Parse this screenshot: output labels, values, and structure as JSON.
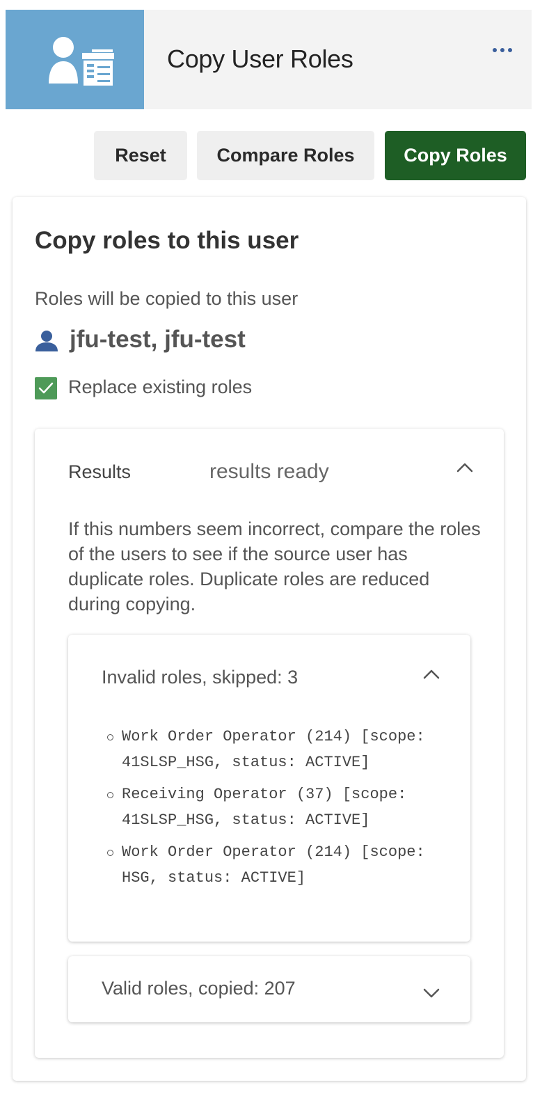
{
  "header": {
    "title": "Copy User Roles",
    "icon": "user-copier-icon",
    "more_icon": "more-horizontal-icon",
    "icon_bg_color": "#6aa6d0"
  },
  "toolbar": {
    "reset_label": "Reset",
    "compare_label": "Compare Roles",
    "copy_label": "Copy Roles",
    "copy_color": "#1e5e25"
  },
  "target": {
    "title": "Copy roles to this user",
    "subtitle": "Roles will be copied to this user",
    "user_icon": "user-icon",
    "user_name": "jfu-test, jfu-test",
    "replace_checked": true,
    "replace_label": "Replace existing roles"
  },
  "results": {
    "label": "Results",
    "status": "results ready",
    "expanded": true,
    "description": "If this numbers seem incorrect, compare the roles of the users to see if the source user has duplicate roles. Duplicate roles are reduced during copying.",
    "invalid": {
      "title": "Invalid roles, skipped: 3",
      "expanded": true,
      "items": [
        "Work Order Operator (214) [scope: 41SLSP_HSG, status: ACTIVE]",
        "Receiving Operator (37) [scope: 41SLSP_HSG, status: ACTIVE]",
        "Work Order Operator (214) [scope: HSG, status: ACTIVE]"
      ]
    },
    "valid": {
      "title": "Valid roles, copied: 207",
      "expanded": false
    }
  }
}
